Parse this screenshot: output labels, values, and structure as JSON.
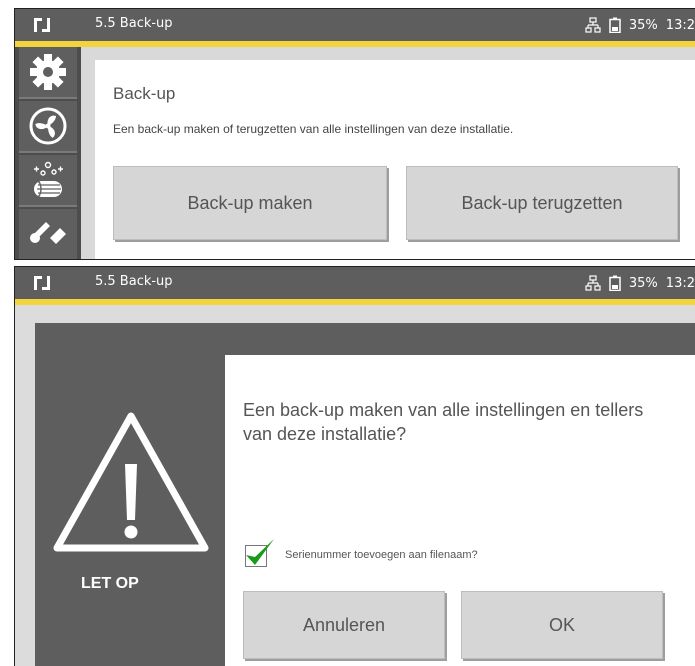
{
  "colors": {
    "header": "#5e5e5e",
    "accent": "#f2d43c",
    "button": "#d6d6d6",
    "check": "#1a9a1a"
  },
  "status": {
    "network_icon": "network-icon",
    "battery_icon": "battery-icon",
    "battery": "35%",
    "time": "13:2"
  },
  "top": {
    "header_title": "5.5 Back-up",
    "sidebar": [
      {
        "icon": "gear-icon"
      },
      {
        "icon": "fan-icon"
      },
      {
        "icon": "filter-icon"
      },
      {
        "icon": "tools-icon"
      }
    ],
    "panel": {
      "title": "Back-up",
      "description": "Een back-up maken of terugzetten van alle instellingen van deze installatie.",
      "make_button": "Back-up maken",
      "restore_button": "Back-up terugzetten"
    }
  },
  "bottom": {
    "header_title": "5.5 Back-up",
    "warning_icon": "warning-triangle-icon",
    "warning_label": "LET OP",
    "message": "Een back-up maken van alle instellingen en tellers van deze installatie?",
    "checkbox": {
      "label": "Serienummer toevoegen aan filenaam?",
      "checked": true
    },
    "cancel_button": "Annuleren",
    "ok_button": "OK"
  }
}
